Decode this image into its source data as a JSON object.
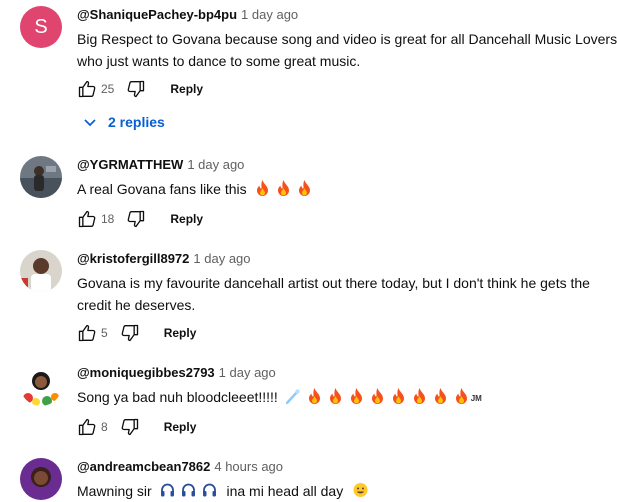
{
  "comments": [
    {
      "author": "@ShaniquePachey-bp4pu",
      "time": "1 day ago",
      "avatar_letter": "S",
      "avatar_color": "#e0456f",
      "text_lines": [
        "Big Respect to Govana because song and video is great for all Dancehall Music Lovers",
        "who just wants to dance to some great music."
      ],
      "likes": "25",
      "reply_label": "Reply",
      "replies_label": "2 replies"
    },
    {
      "author": "@YGRMATTHEW",
      "time": "1 day ago",
      "text": "A real Govana fans like this",
      "emojis": [
        "fire-emoji",
        "fire-emoji",
        "fire-emoji"
      ],
      "likes": "18",
      "reply_label": "Reply"
    },
    {
      "author": "@kristofergill8972",
      "time": "1 day ago",
      "text_lines": [
        "Govana is my favourite dancehall artist out there today, but I don't think he gets the",
        "credit he deserves."
      ],
      "likes": "5",
      "reply_label": "Reply"
    },
    {
      "author": "@moniquegibbes2793",
      "time": "1 day ago",
      "text": "Song ya bad nuh bloodcleeet!!!!!",
      "emojis": [
        "comet-emoji",
        "fire-emoji",
        "fire-emoji",
        "fire-emoji",
        "fire-emoji",
        "fire-emoji",
        "fire-emoji",
        "fire-emoji",
        "fire-emoji"
      ],
      "suffix": "JM",
      "likes": "8",
      "reply_label": "Reply"
    },
    {
      "author": "@andreamcbean7862",
      "time": "4 hours ago",
      "text_before": "Mawning sir",
      "emojis_mid": [
        "headphones-emoji",
        "headphones-emoji",
        "headphones-emoji"
      ],
      "text_after": "ina mi head all day",
      "emoji_end": "grinning-face-emoji"
    }
  ],
  "colors": {
    "link": "#065fd4",
    "secondary_text": "#606060",
    "fire": "#f4511e"
  }
}
